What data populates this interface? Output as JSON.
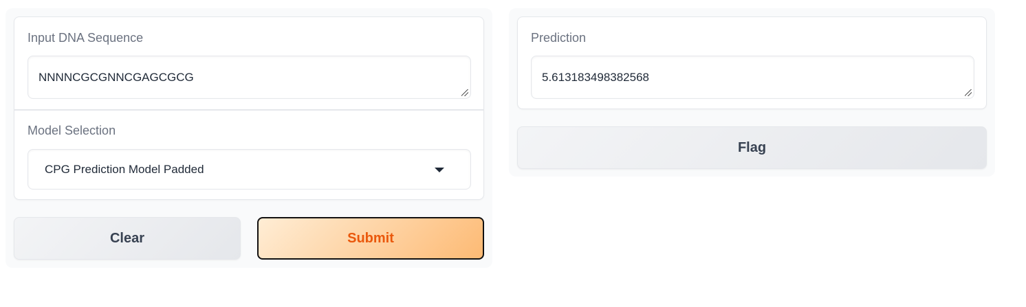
{
  "inputs": {
    "dna_label": "Input DNA Sequence",
    "dna_value": "NNNNCGCGNNCGAGCGCG",
    "model_label": "Model Selection",
    "model_value": "CPG Prediction Model Padded",
    "clear_label": "Clear",
    "submit_label": "Submit"
  },
  "outputs": {
    "prediction_label": "Prediction",
    "prediction_value": "5.613183498382568",
    "flag_label": "Flag"
  },
  "colors": {
    "primary_text": "#ea580c",
    "primary_bg": "#fdba74"
  }
}
